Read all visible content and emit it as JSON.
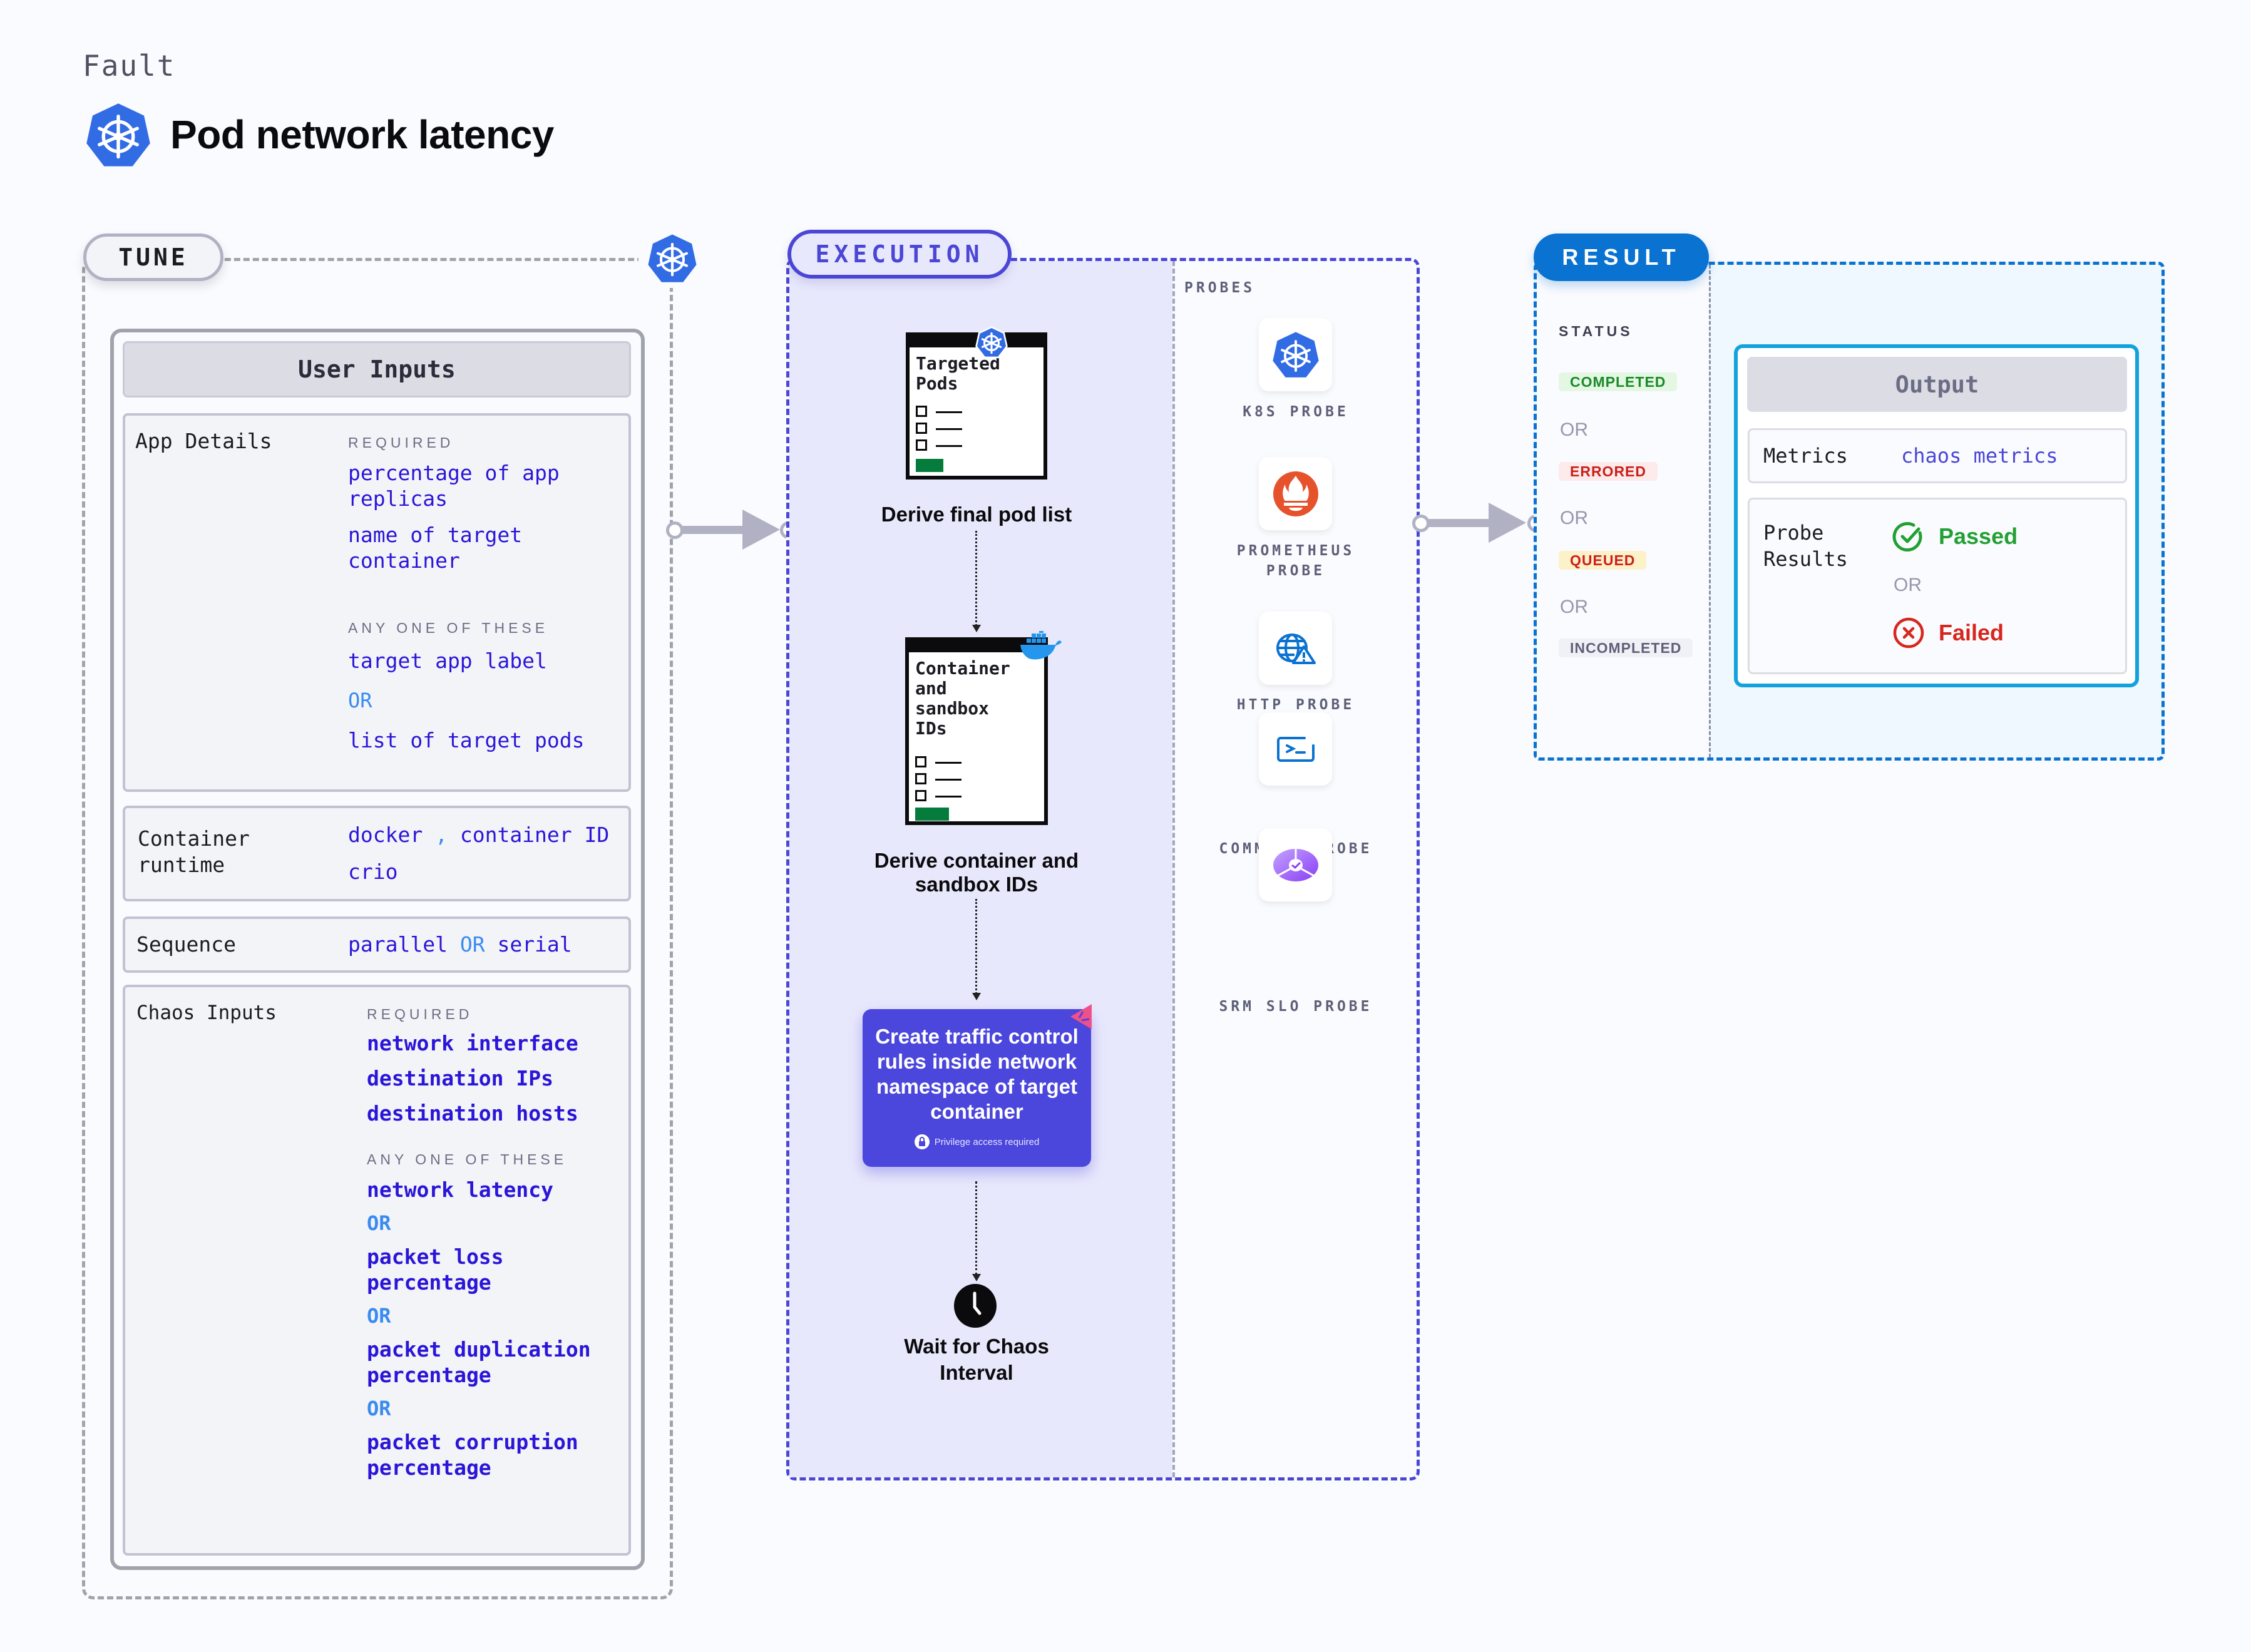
{
  "header": {
    "eyebrow": "Fault",
    "title": "Pod network latency",
    "icon": "kubernetes-icon"
  },
  "tune": {
    "label": "TUNE",
    "user_inputs": {
      "title": "User Inputs",
      "app_details": {
        "label": "App Details",
        "required_tag": "REQUIRED",
        "required": [
          "percentage of app replicas",
          "name of target container"
        ],
        "any_one_tag": "ANY ONE OF THESE",
        "any_one": [
          "target app label",
          "list of target pods"
        ],
        "or": "OR"
      },
      "container_runtime": {
        "label": "Container runtime",
        "line1": [
          "docker",
          ",",
          "container ID"
        ],
        "line2": "crio"
      },
      "sequence": {
        "label": "Sequence",
        "values": [
          "parallel",
          "OR",
          "serial"
        ]
      },
      "chaos_inputs": {
        "label": "Chaos Inputs",
        "required_tag": "REQUIRED",
        "required": [
          "network interface",
          "destination IPs",
          "destination hosts"
        ],
        "any_one_tag": "ANY ONE OF THESE",
        "any_one": [
          "network latency",
          "packet loss percentage",
          "packet duplication percentage",
          "packet corruption percentage"
        ],
        "or": "OR"
      }
    }
  },
  "execution": {
    "label": "EXECUTION",
    "steps": [
      {
        "doc_title": "Targeted Pods",
        "label": "Derive final pod list",
        "badge_icon": "kubernetes-icon"
      },
      {
        "doc_title": "Container and sandbox IDs",
        "label": "Derive container and sandbox IDs",
        "badge_icon": "docker-icon"
      },
      {
        "label": "Create traffic control rules inside network namespace of target container",
        "note": "Privilege access required",
        "badge_icon": "chaos-icon"
      },
      {
        "label": "Wait for Chaos Interval",
        "icon": "clock-icon"
      }
    ],
    "probes": {
      "label": "PROBES",
      "items": [
        {
          "name": "K8S PROBE",
          "icon": "kubernetes-icon"
        },
        {
          "name": "PROMETHEUS PROBE",
          "icon": "prometheus-icon"
        },
        {
          "name": "HTTP PROBE",
          "icon": "http-globe-icon"
        },
        {
          "name": "COMMAND PROBE",
          "icon": "terminal-icon"
        },
        {
          "name": "SRM SLO PROBE",
          "icon": "slo-icon"
        }
      ]
    }
  },
  "result": {
    "label": "RESULT",
    "status_label": "STATUS",
    "statuses": [
      {
        "label": "COMPLETED",
        "color": "#1b8a2a",
        "bg": "#e3f7e3"
      },
      {
        "label": "ERRORED",
        "color": "#cc1f1a",
        "bg": "#fdeaea"
      },
      {
        "label": "QUEUED",
        "color": "#cc1f1a",
        "bg": "#fdf1c9"
      },
      {
        "label": "INCOMPLETED",
        "color": "#5e6078",
        "bg": "#f0f1f6"
      }
    ],
    "or": "OR",
    "output": {
      "title": "Output",
      "metrics_label": "Metrics",
      "metrics_value": "chaos metrics",
      "probe_results_label": "Probe Results",
      "passed": "Passed",
      "failed": "Failed",
      "or": "OR"
    }
  },
  "colors": {
    "execution": "#4b46d6",
    "result": "#0a72d1",
    "value": "#2a15d8",
    "kubernetes": "#326ce5"
  }
}
